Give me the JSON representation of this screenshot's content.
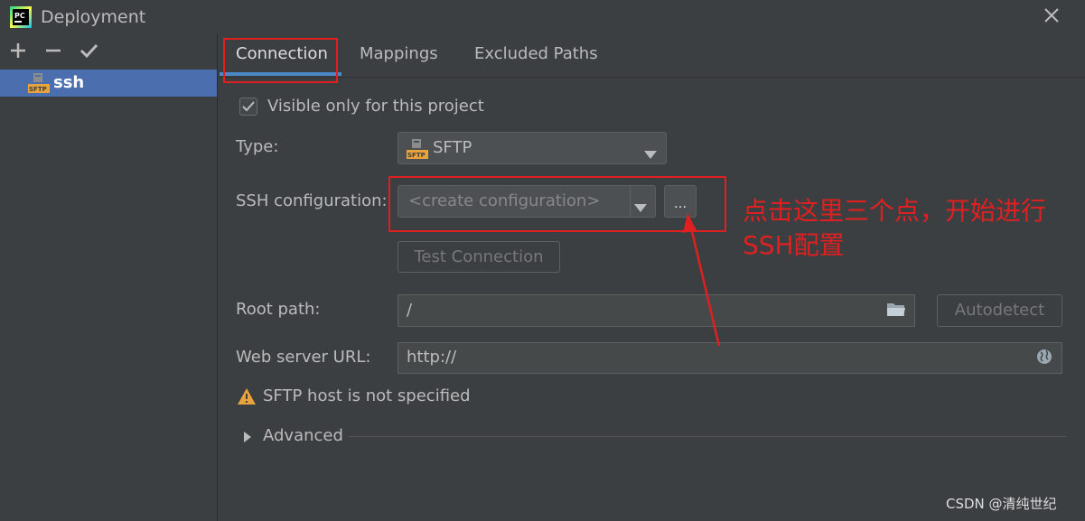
{
  "window": {
    "title": "Deployment",
    "app_icon": "pycharm-logo",
    "app_logo_text": "PC",
    "close_icon": "close-icon"
  },
  "sidebar": {
    "toolbar": [
      "add-icon",
      "remove-icon",
      "check-icon"
    ],
    "servers": [
      {
        "label": "ssh",
        "icon": "sftp-server-icon",
        "icon_text": "SFTP",
        "selected": true
      }
    ]
  },
  "tabs": [
    {
      "label": "Connection",
      "active": true
    },
    {
      "label": "Mappings",
      "active": false
    },
    {
      "label": "Excluded Paths",
      "active": false
    }
  ],
  "form": {
    "visible_only": {
      "label": "Visible only for this project",
      "checked": true
    },
    "type": {
      "label": "Type:",
      "value": "SFTP",
      "icon_text": "SFTP"
    },
    "ssh_config": {
      "label": "SSH configuration:",
      "placeholder": "<create configuration>",
      "more_label": "..."
    },
    "test_connection_label": "Test Connection",
    "root_path": {
      "label": "Root path:",
      "value": "/"
    },
    "autodetect_label": "Autodetect",
    "web_server_url": {
      "label": "Web server URL:",
      "value": "http://"
    },
    "warning": "SFTP host is not specified",
    "advanced_label": "Advanced"
  },
  "annotation": {
    "line1": "点击这里三个点，开始进行",
    "line2": "SSH配置",
    "color": "#e02020"
  },
  "watermark": "CSDN @清纯世纪",
  "colors": {
    "background": "#3c3f41",
    "selection": "#4b6eaf",
    "tab_underline": "#4a88c7",
    "highlight_red": "#e02020",
    "warning": "#e8a33d"
  }
}
